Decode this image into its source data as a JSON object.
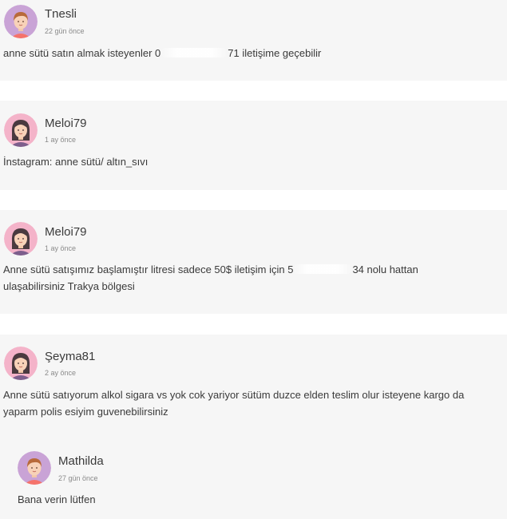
{
  "comments": [
    {
      "username": "Tnesli",
      "time": "22 gün önce",
      "text_before": "anne sütü satın almak isteyenler 0",
      "text_after": "71 iletişime geçebilir",
      "avatar_icon": "woman-short-hair-avatar-icon"
    },
    {
      "username": "Meloi79",
      "time": "1 ay önce",
      "text": "İnstagram: anne sütü/ altın_sıvı",
      "avatar_icon": "woman-long-hair-avatar-icon"
    },
    {
      "username": "Meloi79",
      "time": "1 ay önce",
      "text_line1_before": "Anne sütü satışımız başlamıştır litresi sadece 50$ iletişim için 5",
      "text_line1_after": "34 nolu hattan",
      "text_line2": "ulaşabilirsiniz Trakya bölgesi",
      "avatar_icon": "woman-long-hair-avatar-icon"
    },
    {
      "username": "Şeyma81",
      "time": "2 ay önce",
      "text_line1": "Anne sütü satıyorum alkol sigara vs yok cok yariyor sütüm duzce elden teslim olur isteyene kargo da",
      "text_line2": "yaparm polis esiyim guvenebilirsiniz",
      "avatar_icon": "woman-long-hair-avatar-icon"
    }
  ],
  "reply": {
    "username": "Mathilda",
    "time": "27 gün önce",
    "text": "Bana verin lütfen",
    "avatar_icon": "woman-short-hair-avatar-icon"
  },
  "colors": {
    "card_bg": "#f6f6f6",
    "avatar_purple": "#c9a3d6",
    "avatar_pink": "#f4b3c9"
  }
}
